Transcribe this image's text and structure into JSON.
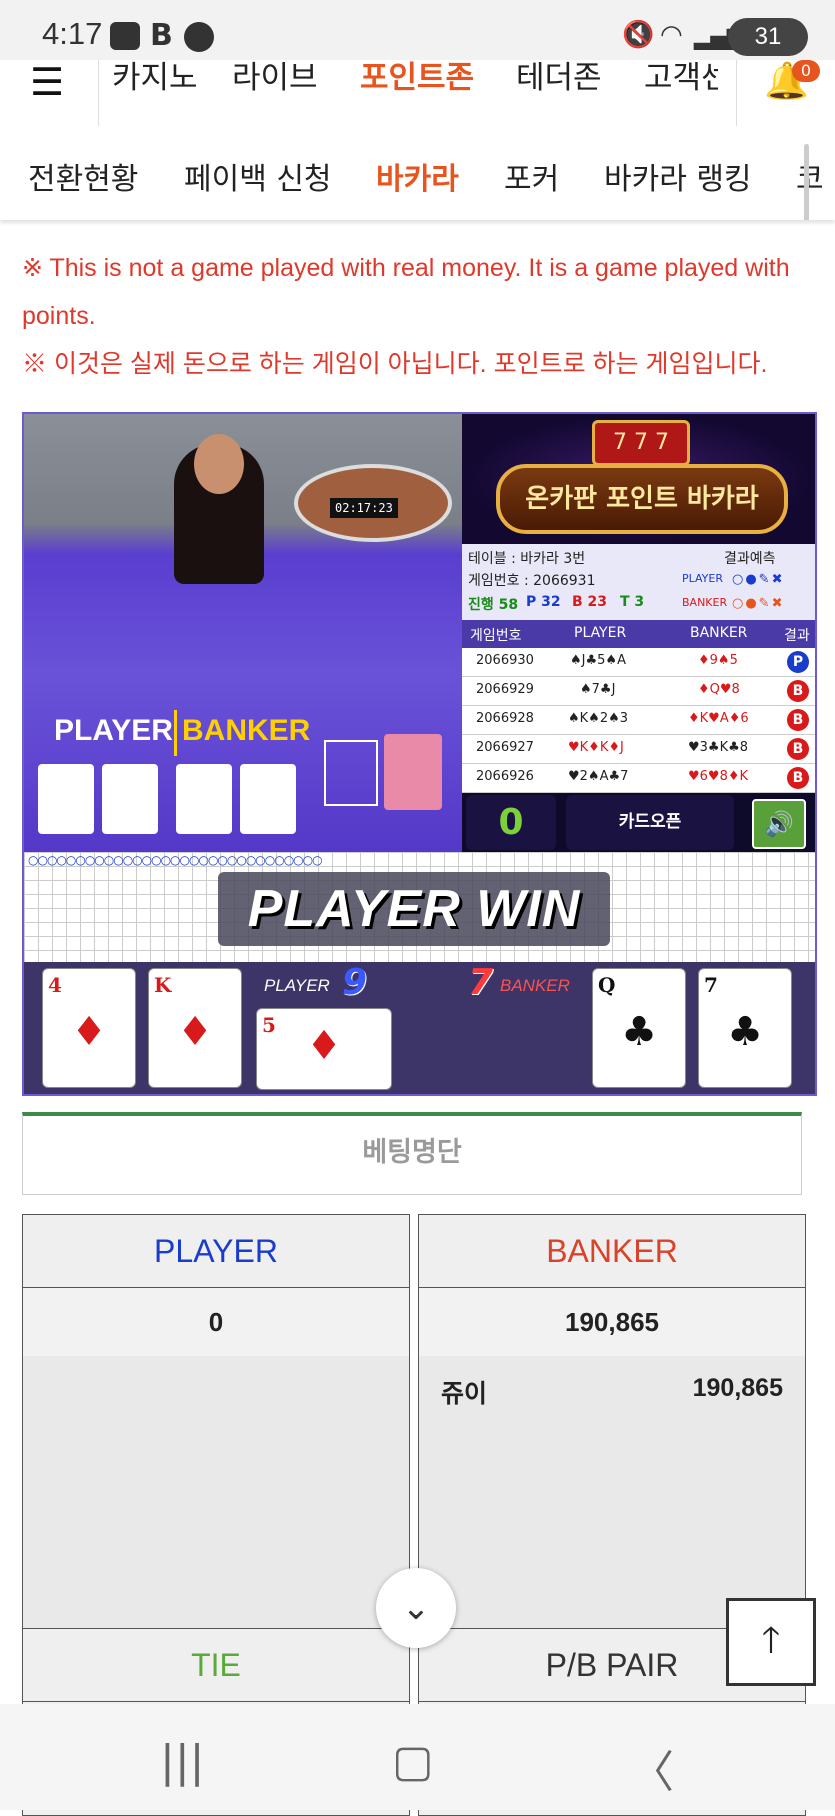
{
  "status_bar": {
    "time": "4:17",
    "battery": "31"
  },
  "top_nav": {
    "items": [
      "카지노",
      "라이브",
      "포인트존",
      "테더존",
      "고객센"
    ],
    "active": "포인트존",
    "notification_count": "0"
  },
  "sub_nav": {
    "items": [
      "전환현황",
      "페이백 신청",
      "바카라",
      "포커",
      "바카라 랭킹",
      "코"
    ],
    "active": "바카라"
  },
  "notice": {
    "english": "※ This is not a game played with real money. It is a game played with points.",
    "korean": "※ 이것은 실제 돈으로 하는 게임이 아닙니다. 포인트로 하는 게임입니다."
  },
  "game": {
    "timer": "02:17:23",
    "logo_text": "온카판 포인트 바카라",
    "table_label": "테이블 : 바카라 3번",
    "game_number_label": "게임번호 : 2066931",
    "prediction_label": "결과예측",
    "progress": {
      "label": "진행",
      "total": "58",
      "p": "P 32",
      "b": "B 23",
      "t": "T 3"
    },
    "prediction_rows": [
      "PLAYER",
      "BANKER"
    ],
    "history_headers": [
      "게임번호",
      "PLAYER",
      "BANKER",
      "결과"
    ],
    "history": [
      {
        "no": "2066930",
        "player": "♠J♣5♠A",
        "banker": "♦9♠5",
        "result": "P"
      },
      {
        "no": "2066929",
        "player": "♠7♣J",
        "banker": "♦Q♥8",
        "result": "B"
      },
      {
        "no": "2066928",
        "player": "♠K♠2♠3",
        "banker": "♦K♥A♦6",
        "result": "B"
      },
      {
        "no": "2066927",
        "player": "♥K♦K♦J",
        "banker": "♥3♣K♣8",
        "result": "B"
      },
      {
        "no": "2066926",
        "player": "♥2♠A♣7",
        "banker": "♥6♥8♦K",
        "result": "B"
      }
    ],
    "bet_amount": "0",
    "card_open_label": "카드오픈",
    "table_player": "PLAYER",
    "table_banker": "BANKER",
    "win_banner": "PLAYER WIN",
    "player_label": "PLAYER",
    "player_score": "9",
    "banker_label": "BANKER",
    "banker_score": "7",
    "player_cards": [
      {
        "rank": "4",
        "suit": "♦"
      },
      {
        "rank": "K",
        "suit": "♦"
      },
      {
        "rank": "5",
        "suit": "♦"
      }
    ],
    "banker_cards": [
      {
        "rank": "Q",
        "suit": "♣"
      },
      {
        "rank": "7",
        "suit": "♣"
      }
    ]
  },
  "betting": {
    "list_title": "베팅명단",
    "player": {
      "label": "PLAYER",
      "total": "0",
      "color": "#1a3ccc"
    },
    "banker": {
      "label": "BANKER",
      "total": "190,865",
      "color": "#d8432a",
      "entries": [
        {
          "name": "쥬이",
          "amount": "190,865"
        }
      ]
    },
    "tie": {
      "label": "TIE",
      "color": "#5aaa3a"
    },
    "pair": {
      "label": "P/B PAIR",
      "color": "#333333"
    }
  },
  "colors": {
    "accent": "#e8541e",
    "notice": "#e0382a",
    "player_blue": "#1a3ccc",
    "banker_red": "#d8432a"
  }
}
